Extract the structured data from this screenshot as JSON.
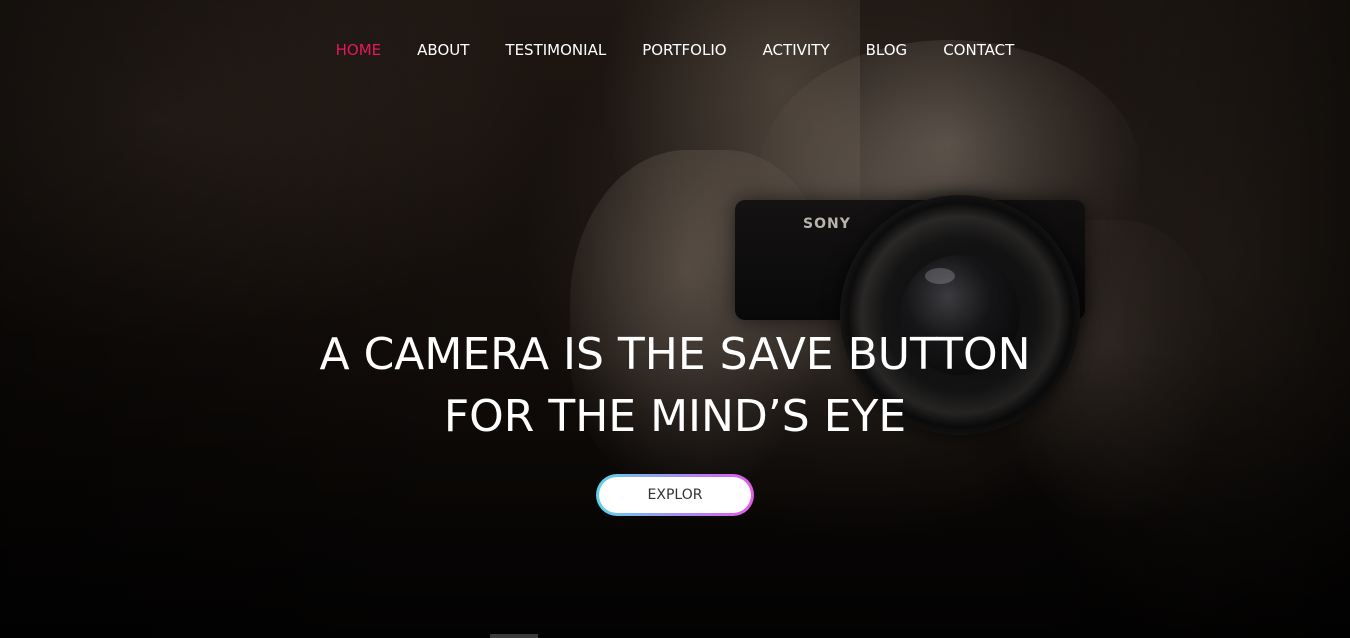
{
  "nav": {
    "items": [
      {
        "label": "HOME",
        "active": true
      },
      {
        "label": "ABOUT",
        "active": false
      },
      {
        "label": "TESTIMONIAL",
        "active": false
      },
      {
        "label": "PORTFOLIO",
        "active": false
      },
      {
        "label": "ACTIVITY",
        "active": false
      },
      {
        "label": "BLOG",
        "active": false
      },
      {
        "label": "CONTACT",
        "active": false
      }
    ],
    "active_color": "#e6195c",
    "text_color": "#ffffff"
  },
  "hero": {
    "headline_line1": "A CAMERA IS THE SAVE BUTTON",
    "headline_line2": "FOR THE MIND’S EYE",
    "cta_label": "EXPLOR",
    "background_image": "woman-with-camera-photo",
    "camera_brand": "SONY",
    "cta_gradient": [
      "#5fd2ec",
      "#e25be8"
    ]
  }
}
